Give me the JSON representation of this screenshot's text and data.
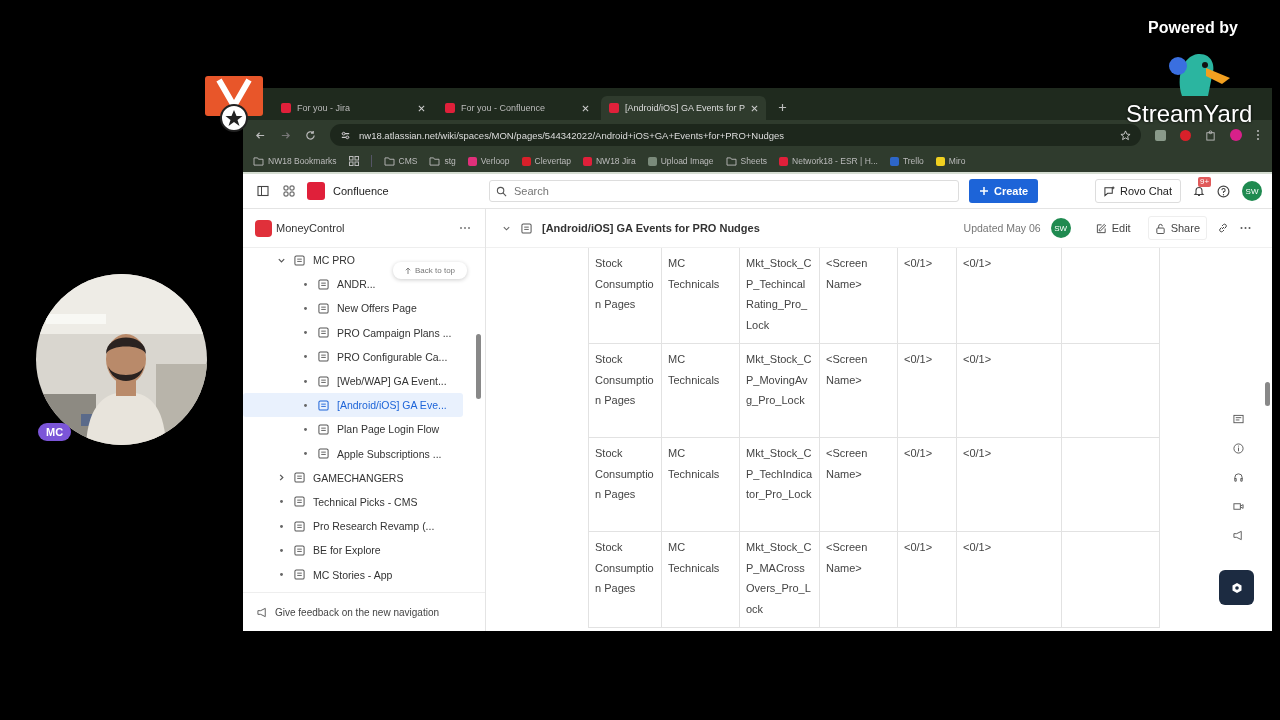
{
  "stream": {
    "powered_by": "Powered by",
    "brand": "StreamYard",
    "participant": {
      "initials": "MC"
    }
  },
  "browser": {
    "tabs": [
      {
        "title": "For you - Jira",
        "selected": false
      },
      {
        "title": "For you - Confluence",
        "selected": false
      },
      {
        "title": "[Android/iOS] GA Events for P",
        "selected": true
      }
    ],
    "address": "nw18.atlassian.net/wiki/spaces/MON/pages/544342022/Android+iOS+GA+Events+for+PRO+Nudges",
    "bookmarks": [
      {
        "label": "NW18 Bookmarks",
        "kind": "folder"
      },
      {
        "label": "CMS",
        "kind": "folder"
      },
      {
        "label": "stg",
        "kind": "folder"
      },
      {
        "label": "Verloop",
        "kind": "site",
        "color": "#e0307a"
      },
      {
        "label": "Clevertap",
        "kind": "site",
        "color": "#d8202a"
      },
      {
        "label": "NW18 Jira",
        "kind": "site",
        "color": "#e0203a"
      },
      {
        "label": "Upload Image",
        "kind": "site",
        "color": "#7a8a7a"
      },
      {
        "label": "Sheets",
        "kind": "folder"
      },
      {
        "label": "Network18 - ESR | H...",
        "kind": "site",
        "color": "#e0203a"
      },
      {
        "label": "Trello",
        "kind": "site",
        "color": "#2d66c8"
      },
      {
        "label": "Miro",
        "kind": "site",
        "color": "#f0d020"
      }
    ]
  },
  "app": {
    "name": "Confluence",
    "search": {
      "placeholder": "Search"
    },
    "create": "Create",
    "rovo": "Rovo Chat",
    "notifications": "9+",
    "avatar": "SW"
  },
  "sidebar": {
    "space": "MoneyControl",
    "tooltip": "Back to top",
    "items": [
      {
        "title": "MC PRO",
        "kind": "parent",
        "expanded": true,
        "selected": false,
        "children": [
          {
            "title": "ANDR...",
            "kind": "page",
            "selected": false
          },
          {
            "title": "New Offers Page",
            "kind": "page",
            "selected": false
          },
          {
            "title": "PRO Campaign Plans ...",
            "kind": "page",
            "selected": false
          },
          {
            "title": "PRO Configurable Ca...",
            "kind": "page",
            "selected": false
          },
          {
            "title": "[Web/WAP] GA Event...",
            "kind": "page",
            "selected": false
          },
          {
            "title": "[Android/iOS] GA Eve...",
            "kind": "page",
            "selected": true
          },
          {
            "title": "Plan Page Login Flow",
            "kind": "page",
            "selected": false
          },
          {
            "title": "Apple Subscriptions ...",
            "kind": "page",
            "selected": false
          }
        ]
      },
      {
        "title": "GAMECHANGERS",
        "kind": "parent",
        "expanded": false,
        "selected": false
      },
      {
        "title": "Technical Picks - CMS",
        "kind": "page",
        "selected": false
      },
      {
        "title": "Pro Research Revamp (...",
        "kind": "page",
        "selected": false
      },
      {
        "title": "BE for Explore",
        "kind": "page",
        "selected": false
      },
      {
        "title": "MC Stories - App",
        "kind": "page",
        "selected": false
      }
    ],
    "feedback": "Give feedback on the new navigation"
  },
  "page": {
    "title": "[Android/iOS] GA Events for PRO Nudges",
    "updated": "Updated May 06",
    "author": "SW",
    "edit": "Edit",
    "share": "Share"
  },
  "table": {
    "rows": [
      {
        "cells": [
          "Stock Consumption Pages",
          "MC Technicals",
          "Mkt_Stock_CP_TechincalRating_Pro_Lock",
          "<Screen Name>",
          "<0/1>",
          "<0/1>"
        ]
      },
      {
        "cells": [
          "Stock Consumption Pages",
          "MC Technicals",
          "Mkt_Stock_CP_MovingAvg_Pro_Lock",
          "<Screen Name>",
          "<0/1>",
          "<0/1>"
        ]
      },
      {
        "cells": [
          "Stock Consumption Pages",
          "MC Technicals",
          "Mkt_Stock_CP_TechIndicator_Pro_Lock",
          "<Screen Name>",
          "<0/1>",
          "<0/1>"
        ]
      },
      {
        "cells": [
          "Stock Consumption Pages",
          "MC Technicals",
          "Mkt_Stock_CP_MACrossOvers_Pro_Lock",
          "<Screen Name>",
          "<0/1>",
          "<0/1>"
        ]
      }
    ]
  }
}
